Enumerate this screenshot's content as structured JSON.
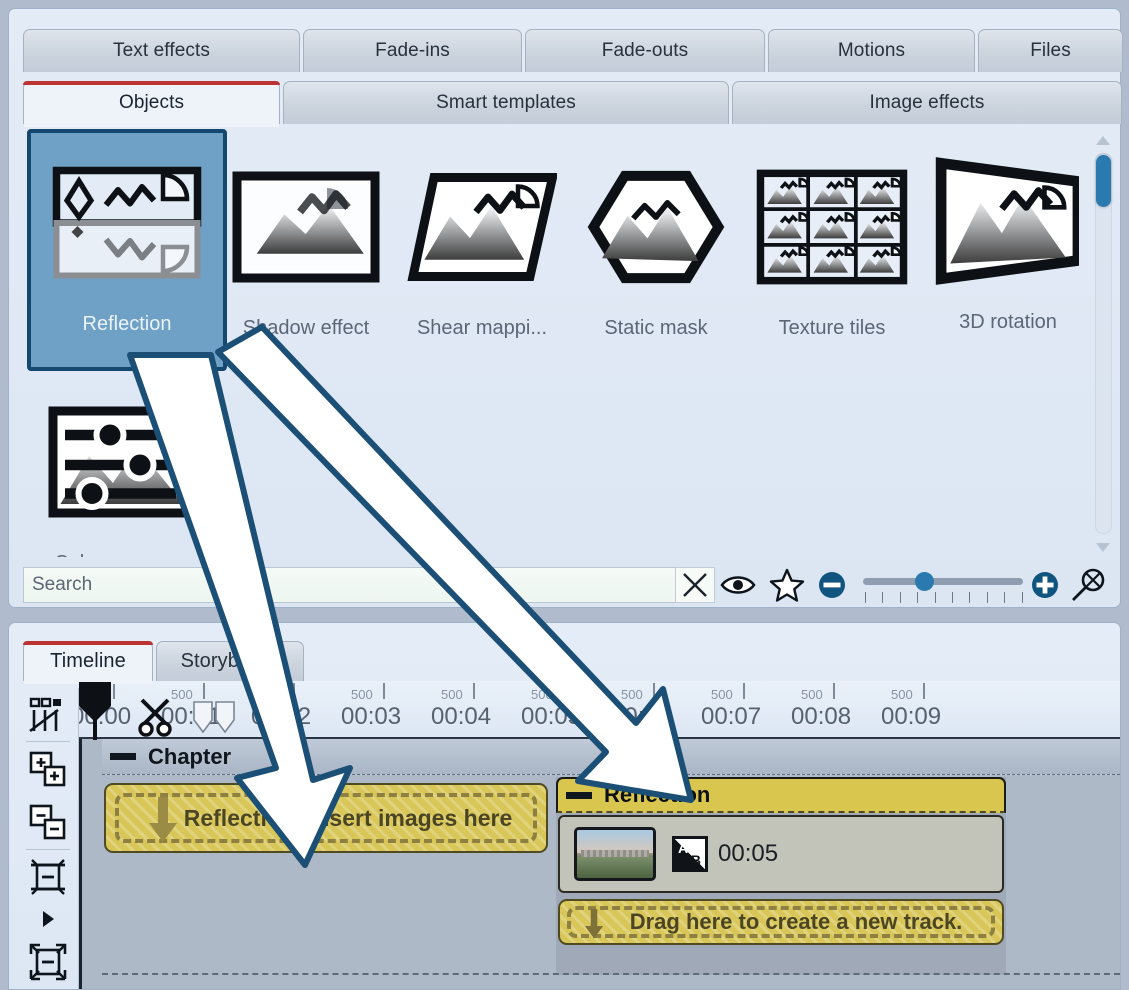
{
  "tabs_row1": [
    {
      "label": "Text effects",
      "active": false
    },
    {
      "label": "Fade-ins",
      "active": false
    },
    {
      "label": "Fade-outs",
      "active": false
    },
    {
      "label": "Motions",
      "active": false
    },
    {
      "label": "Files",
      "active": false
    }
  ],
  "tabs_row2": [
    {
      "label": "Objects",
      "active": true
    },
    {
      "label": "Smart templates",
      "active": false
    },
    {
      "label": "Image effects",
      "active": false
    }
  ],
  "effects": [
    {
      "label": "Reflection",
      "icon": "reflection-thumb",
      "selected": true
    },
    {
      "label": "Shadow effect",
      "icon": "shadow-effect-thumb",
      "selected": false
    },
    {
      "label": "Shear mappi...",
      "icon": "shear-mapping-thumb",
      "selected": false
    },
    {
      "label": "Static mask",
      "icon": "static-mask-thumb",
      "selected": false
    },
    {
      "label": "Texture tiles",
      "icon": "texture-tiles-thumb",
      "selected": false
    },
    {
      "label": "3D rotation",
      "icon": "3d-rotation-thumb",
      "selected": false
    },
    {
      "label": "Color curve a...",
      "icon": "color-curve-thumb",
      "selected": false
    }
  ],
  "search": {
    "placeholder": "Search",
    "value": "",
    "clear_icon": "close-x-icon",
    "preview_icon": "eye-icon",
    "favorite_icon": "star-icon",
    "zoom_out_icon": "minus-circle-icon",
    "zoom_in_icon": "plus-circle-icon",
    "reset_zoom_icon": "magnifier-reset-icon",
    "slider_value": 33
  },
  "scrollbar": {
    "up_icon": "triangle-up-icon",
    "down_icon": "triangle-down-icon",
    "thumb_position_pct": 1
  },
  "timeline": {
    "tabs": [
      {
        "label": "Timeline",
        "active": true
      },
      {
        "label": "Storyboard",
        "active": false
      }
    ],
    "toolbar": [
      {
        "icon": "object-mode-icon"
      },
      {
        "icon": "add-object-icon"
      },
      {
        "icon": "remove-object-icon"
      },
      {
        "icon": "fit-height-icon"
      },
      {
        "icon": "expand-arrow-icon"
      },
      {
        "icon": "fit-all-icon"
      }
    ],
    "ruler": {
      "labels": [
        "00:00",
        "00:01",
        "00:02",
        "00:03",
        "00:04",
        "00:05",
        "00:06",
        "00:07",
        "00:08",
        "00:09"
      ],
      "subdivision_label": "500"
    },
    "playhead_icon": "playhead-marker-icon",
    "scissors_icon": "scissors-icon",
    "range_marker_icon": "range-marker-icon",
    "chapter": {
      "label": "Chapter",
      "collapse_icon": "collapse-dash-icon"
    },
    "clip_left": {
      "label": "Reflection: Insert images here",
      "drop_icon": "down-arrow-icon"
    },
    "track_right": {
      "header_label": "Reflection",
      "collapse_icon": "collapse-dash-icon",
      "clip_transition_icon": "ab-transition-icon",
      "clip_duration": "00:05",
      "thumbnail": "city-skyline-thumbnail"
    },
    "new_track": {
      "label": "Drag here to create a new track.",
      "drop_icon": "down-arrow-icon"
    }
  },
  "overlay": {
    "arrow1": "drag-arrow-to-left-clip",
    "arrow2": "drag-arrow-to-reflection-track"
  },
  "colors": {
    "accent_blue": "#2a7ab0",
    "selected_tile_bg": "#6fa0c6",
    "selected_tile_border": "#14486e",
    "clip_yellow": "#d8c64f",
    "active_tab_underline": "#bb3333",
    "panel_bg": "#e3ebf6",
    "track_bg": "#aeb9c8"
  }
}
